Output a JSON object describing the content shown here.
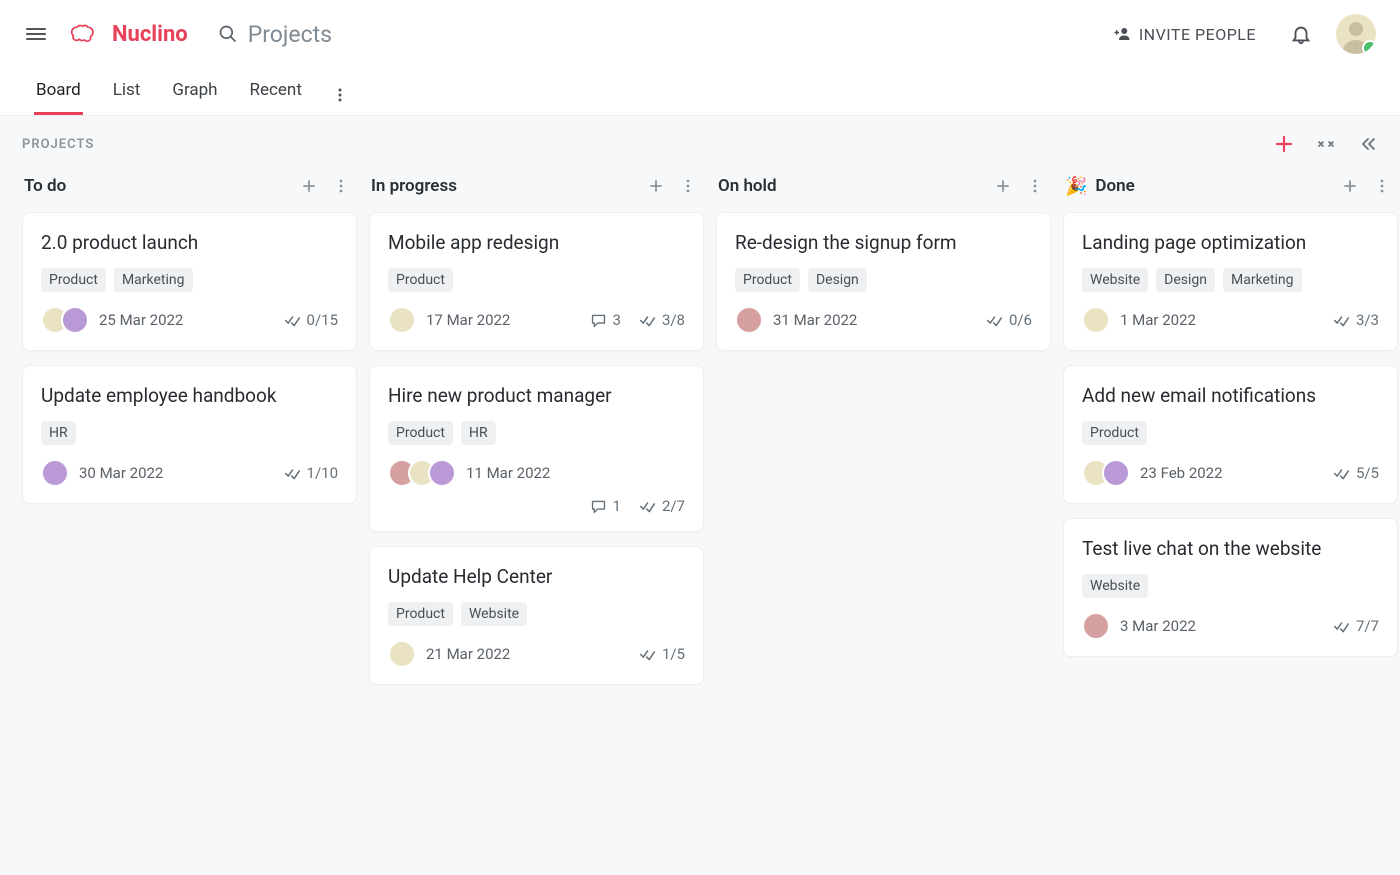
{
  "app": {
    "logo_text": "Nuclino",
    "search_placeholder": "Projects",
    "invite_label": "INVITE PEOPLE"
  },
  "tabs": {
    "items": [
      "Board",
      "List",
      "Graph",
      "Recent"
    ],
    "active_index": 0
  },
  "board": {
    "section_label": "PROJECTS",
    "columns": [
      {
        "title": "To do",
        "emoji": "",
        "cards": [
          {
            "title": "2.0 product launch",
            "tags": [
              "Product",
              "Marketing"
            ],
            "avatars": [
              "c1",
              "c2"
            ],
            "date": "25 Mar 2022",
            "comments": null,
            "checklist": "0/15",
            "second_row": false
          },
          {
            "title": "Update employee handbook",
            "tags": [
              "HR"
            ],
            "avatars": [
              "c2"
            ],
            "date": "30 Mar 2022",
            "comments": null,
            "checklist": "1/10",
            "second_row": false
          }
        ]
      },
      {
        "title": "In progress",
        "emoji": "",
        "cards": [
          {
            "title": "Mobile app redesign",
            "tags": [
              "Product"
            ],
            "avatars": [
              "c1"
            ],
            "date": "17 Mar 2022",
            "comments": "3",
            "checklist": "3/8",
            "second_row": false
          },
          {
            "title": "Hire new product manager",
            "tags": [
              "Product",
              "HR"
            ],
            "avatars": [
              "c3",
              "c1",
              "c2"
            ],
            "date": "11 Mar 2022",
            "comments": "1",
            "checklist": "2/7",
            "second_row": true
          },
          {
            "title": "Update Help Center",
            "tags": [
              "Product",
              "Website"
            ],
            "avatars": [
              "c1"
            ],
            "date": "21 Mar 2022",
            "comments": null,
            "checklist": "1/5",
            "second_row": false
          }
        ]
      },
      {
        "title": "On hold",
        "emoji": "",
        "cards": [
          {
            "title": "Re-design the signup form",
            "tags": [
              "Product",
              "Design"
            ],
            "avatars": [
              "c3"
            ],
            "date": "31 Mar 2022",
            "comments": null,
            "checklist": "0/6",
            "second_row": false
          }
        ]
      },
      {
        "title": "Done",
        "emoji": "🎉",
        "cards": [
          {
            "title": "Landing page optimization",
            "tags": [
              "Website",
              "Design",
              "Marketing"
            ],
            "avatars": [
              "c1"
            ],
            "date": "1 Mar 2022",
            "comments": null,
            "checklist": "3/3",
            "second_row": false
          },
          {
            "title": "Add new email notifications",
            "tags": [
              "Product"
            ],
            "avatars": [
              "c1",
              "c2"
            ],
            "date": "23 Feb 2022",
            "comments": null,
            "checklist": "5/5",
            "second_row": false
          },
          {
            "title": "Test live chat on the website",
            "tags": [
              "Website"
            ],
            "avatars": [
              "c3"
            ],
            "date": "3 Mar 2022",
            "comments": null,
            "checklist": "7/7",
            "second_row": false
          }
        ]
      }
    ]
  }
}
